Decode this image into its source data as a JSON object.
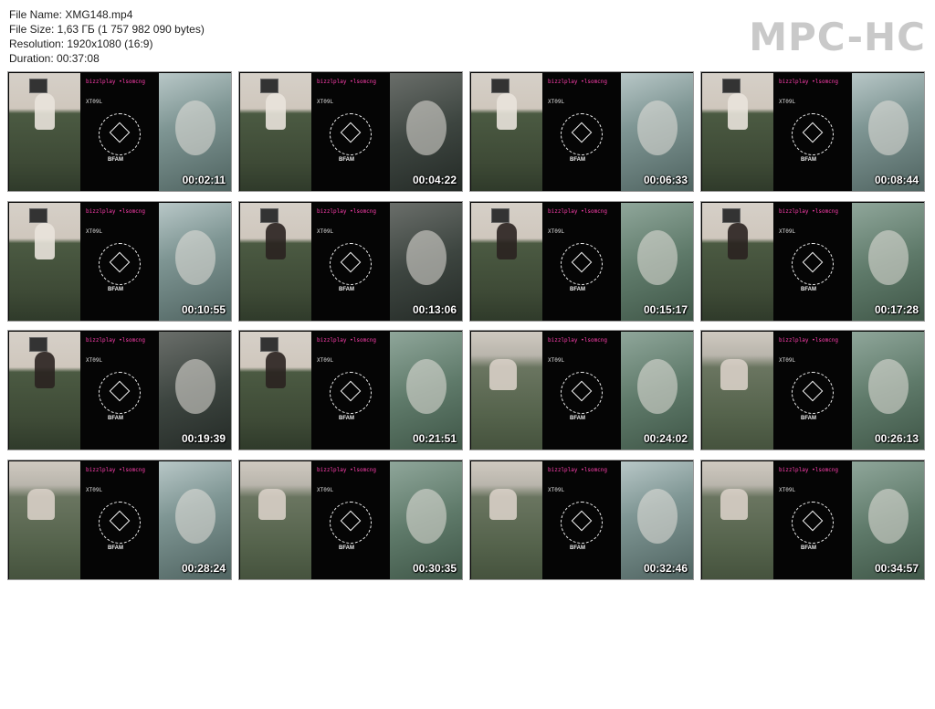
{
  "info": {
    "file_name": "File Name: XMG148.mp4",
    "file_size": "File Size: 1,63 ГБ (1 757 982 090 bytes)",
    "resolution": "Resolution: 1920x1080 (16:9)",
    "duration": "Duration: 00:37:08"
  },
  "brand": "MPC-HC",
  "overlay": {
    "tag": "bizzlplay •lsomcng",
    "code": "XT09L",
    "emblem_label": "BFAM"
  },
  "thumbnails": [
    {
      "time": "00:02:11"
    },
    {
      "time": "00:04:22"
    },
    {
      "time": "00:06:33"
    },
    {
      "time": "00:08:44"
    },
    {
      "time": "00:10:55"
    },
    {
      "time": "00:13:06"
    },
    {
      "time": "00:15:17"
    },
    {
      "time": "00:17:28"
    },
    {
      "time": "00:19:39"
    },
    {
      "time": "00:21:51"
    },
    {
      "time": "00:24:02"
    },
    {
      "time": "00:26:13"
    },
    {
      "time": "00:28:24"
    },
    {
      "time": "00:30:35"
    },
    {
      "time": "00:32:46"
    },
    {
      "time": "00:34:57"
    }
  ]
}
